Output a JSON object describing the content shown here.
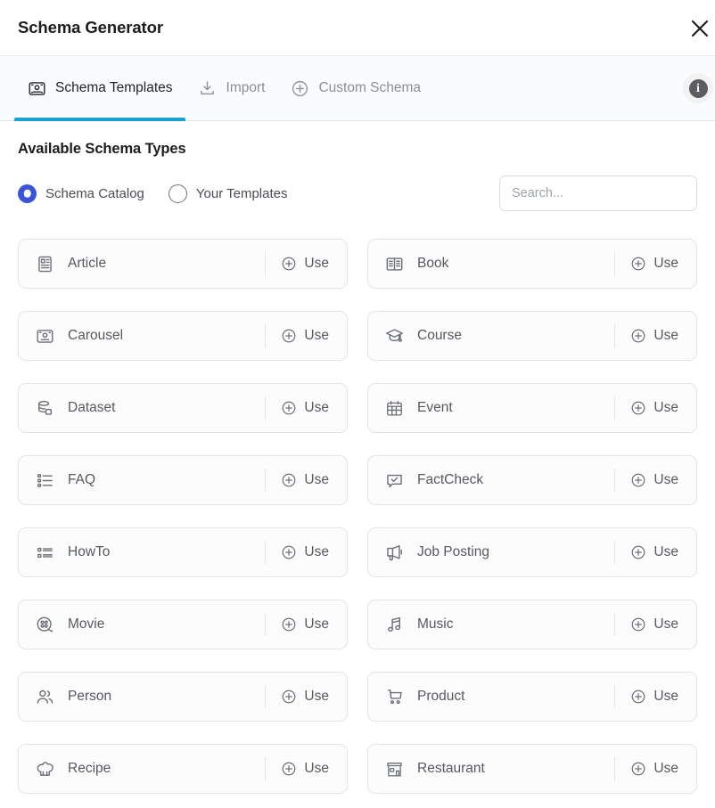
{
  "window": {
    "title": "Schema Generator",
    "close_label": "×"
  },
  "colors": {
    "accent_tab_underline": "#1ba0d4",
    "radio_selected": "#3a54d8",
    "info_badge": "#5b5d60",
    "card_border": "#e2e5e8",
    "text_primary": "#1d1d1f",
    "text_secondary": "#56595e"
  },
  "tabs": [
    {
      "label": "Schema Templates",
      "icon": "schema-template-icon",
      "active": true
    },
    {
      "label": "Import",
      "icon": "import-download-icon",
      "active": false
    },
    {
      "label": "Custom Schema",
      "icon": "plus-circle-icon",
      "active": false
    }
  ],
  "info_button": {
    "glyph": "i",
    "name": "info-icon"
  },
  "section": {
    "title": "Available Schema Types"
  },
  "source_toggle": {
    "options": [
      {
        "label": "Schema Catalog",
        "selected": true
      },
      {
        "label": "Your Templates",
        "selected": false
      }
    ]
  },
  "search": {
    "placeholder": "Search...",
    "value": ""
  },
  "use_label": "Use",
  "schema_types": [
    {
      "label": "Article",
      "icon": "article-document-icon"
    },
    {
      "label": "Book",
      "icon": "book-open-icon"
    },
    {
      "label": "Carousel",
      "icon": "carousel-frame-icon"
    },
    {
      "label": "Course",
      "icon": "graduation-cap-icon"
    },
    {
      "label": "Dataset",
      "icon": "database-icon"
    },
    {
      "label": "Event",
      "icon": "calendar-icon"
    },
    {
      "label": "FAQ",
      "icon": "list-three-rows-icon"
    },
    {
      "label": "FactCheck",
      "icon": "speech-bubble-check-icon"
    },
    {
      "label": "HowTo",
      "icon": "list-two-rows-icon"
    },
    {
      "label": "Job Posting",
      "icon": "megaphone-icon"
    },
    {
      "label": "Movie",
      "icon": "film-reel-icon"
    },
    {
      "label": "Music",
      "icon": "music-note-icon"
    },
    {
      "label": "Person",
      "icon": "people-icon"
    },
    {
      "label": "Product",
      "icon": "shopping-cart-icon"
    },
    {
      "label": "Recipe",
      "icon": "chef-hat-icon"
    },
    {
      "label": "Restaurant",
      "icon": "storefront-icon"
    }
  ]
}
